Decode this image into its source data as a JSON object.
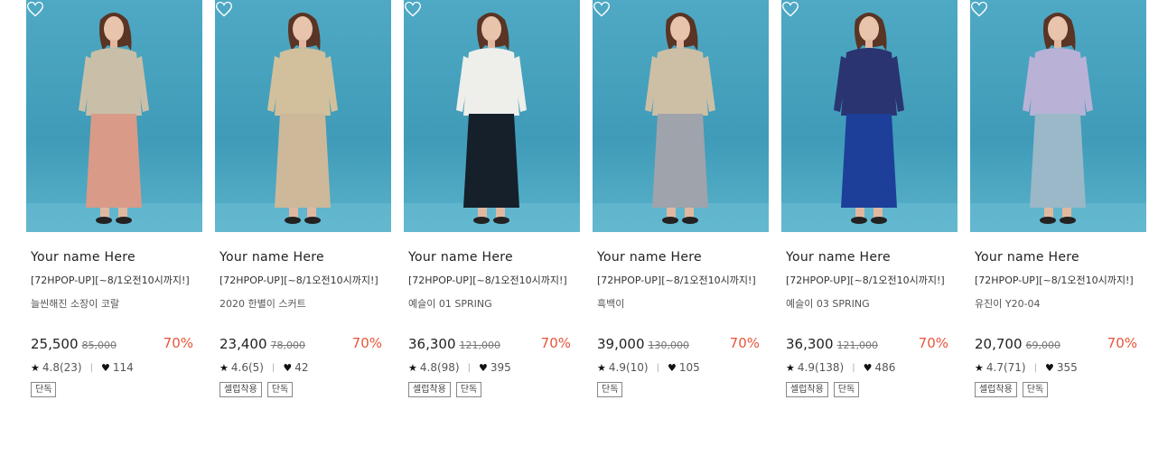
{
  "accent": "#e8553a",
  "products": [
    {
      "brand": "Your name Here",
      "promo": "[72HPOP-UP][~8/1오전10시까지!]",
      "name": "늘씬해진 소장이 코랄",
      "price": "25,500",
      "original_price": "85,000",
      "discount": "70%",
      "rating": "4.8(23)",
      "likes": "114",
      "tags": [
        "단독"
      ],
      "top_color": "#c9bfa8",
      "bottom_color": "#d99a88"
    },
    {
      "brand": "Your name Here",
      "promo": "[72HPOP-UP][~8/1오전10시까지!]",
      "name": "2020 한별이 스커트",
      "price": "23,400",
      "original_price": "78,000",
      "discount": "70%",
      "rating": "4.6(5)",
      "likes": "42",
      "tags": [
        "셀럽착용",
        "단독"
      ],
      "top_color": "#d2c09c",
      "bottom_color": "#cdb89a"
    },
    {
      "brand": "Your name Here",
      "promo": "[72HPOP-UP][~8/1오전10시까지!]",
      "name": "예슬이 01 SPRING",
      "price": "36,300",
      "original_price": "121,000",
      "discount": "70%",
      "rating": "4.8(98)",
      "likes": "395",
      "tags": [
        "셀럽착용",
        "단독"
      ],
      "top_color": "#eeeeea",
      "bottom_color": "#15202a"
    },
    {
      "brand": "Your name Here",
      "promo": "[72HPOP-UP][~8/1오전10시까지!]",
      "name": "흑백이",
      "price": "39,000",
      "original_price": "130,000",
      "discount": "70%",
      "rating": "4.9(10)",
      "likes": "105",
      "tags": [
        "단독"
      ],
      "top_color": "#cdbfa5",
      "bottom_color": "#9fa3ab"
    },
    {
      "brand": "Your name Here",
      "promo": "[72HPOP-UP][~8/1오전10시까지!]",
      "name": "예슬이 03 SPRING",
      "price": "36,300",
      "original_price": "121,000",
      "discount": "70%",
      "rating": "4.9(138)",
      "likes": "486",
      "tags": [
        "셀럽착용",
        "단독"
      ],
      "top_color": "#2a3470",
      "bottom_color": "#1d3f9a"
    },
    {
      "brand": "Your name Here",
      "promo": "[72HPOP-UP][~8/1오전10시까지!]",
      "name": "유진이 Y20-04",
      "price": "20,700",
      "original_price": "69,000",
      "discount": "70%",
      "rating": "4.7(71)",
      "likes": "355",
      "tags": [
        "셀럽착용",
        "단독"
      ],
      "top_color": "#b9b2d6",
      "bottom_color": "#9ab8c8"
    }
  ]
}
